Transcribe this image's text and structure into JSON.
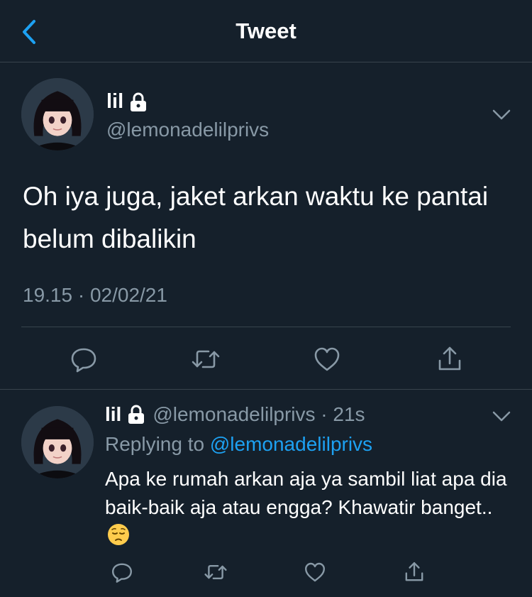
{
  "header": {
    "title": "Tweet",
    "back_icon": "chevron-left-icon"
  },
  "colors": {
    "background": "#15202b",
    "accent": "#1da1f2",
    "muted": "#8899a6",
    "divider": "#38444d"
  },
  "tweet": {
    "name": "lil",
    "handle": "@lemonadelilprivs",
    "text": "Oh iya juga, jaket arkan waktu ke pantai belum dibalikin",
    "timestamp": "19.15 · 02/02/21",
    "actions": [
      "reply-icon",
      "retweet-icon",
      "like-icon",
      "share-icon"
    ]
  },
  "reply": {
    "name": "lil",
    "handle_time": "@lemonadelilprivs · 21s",
    "replying_prefix": "Replying to ",
    "replying_handle": "@lemonadelilprivs",
    "text": "Apa ke rumah arkan aja ya sambil liat apa dia baik-baik aja atau engga? Khawatir banget..",
    "emoji": "pensive-face"
  }
}
